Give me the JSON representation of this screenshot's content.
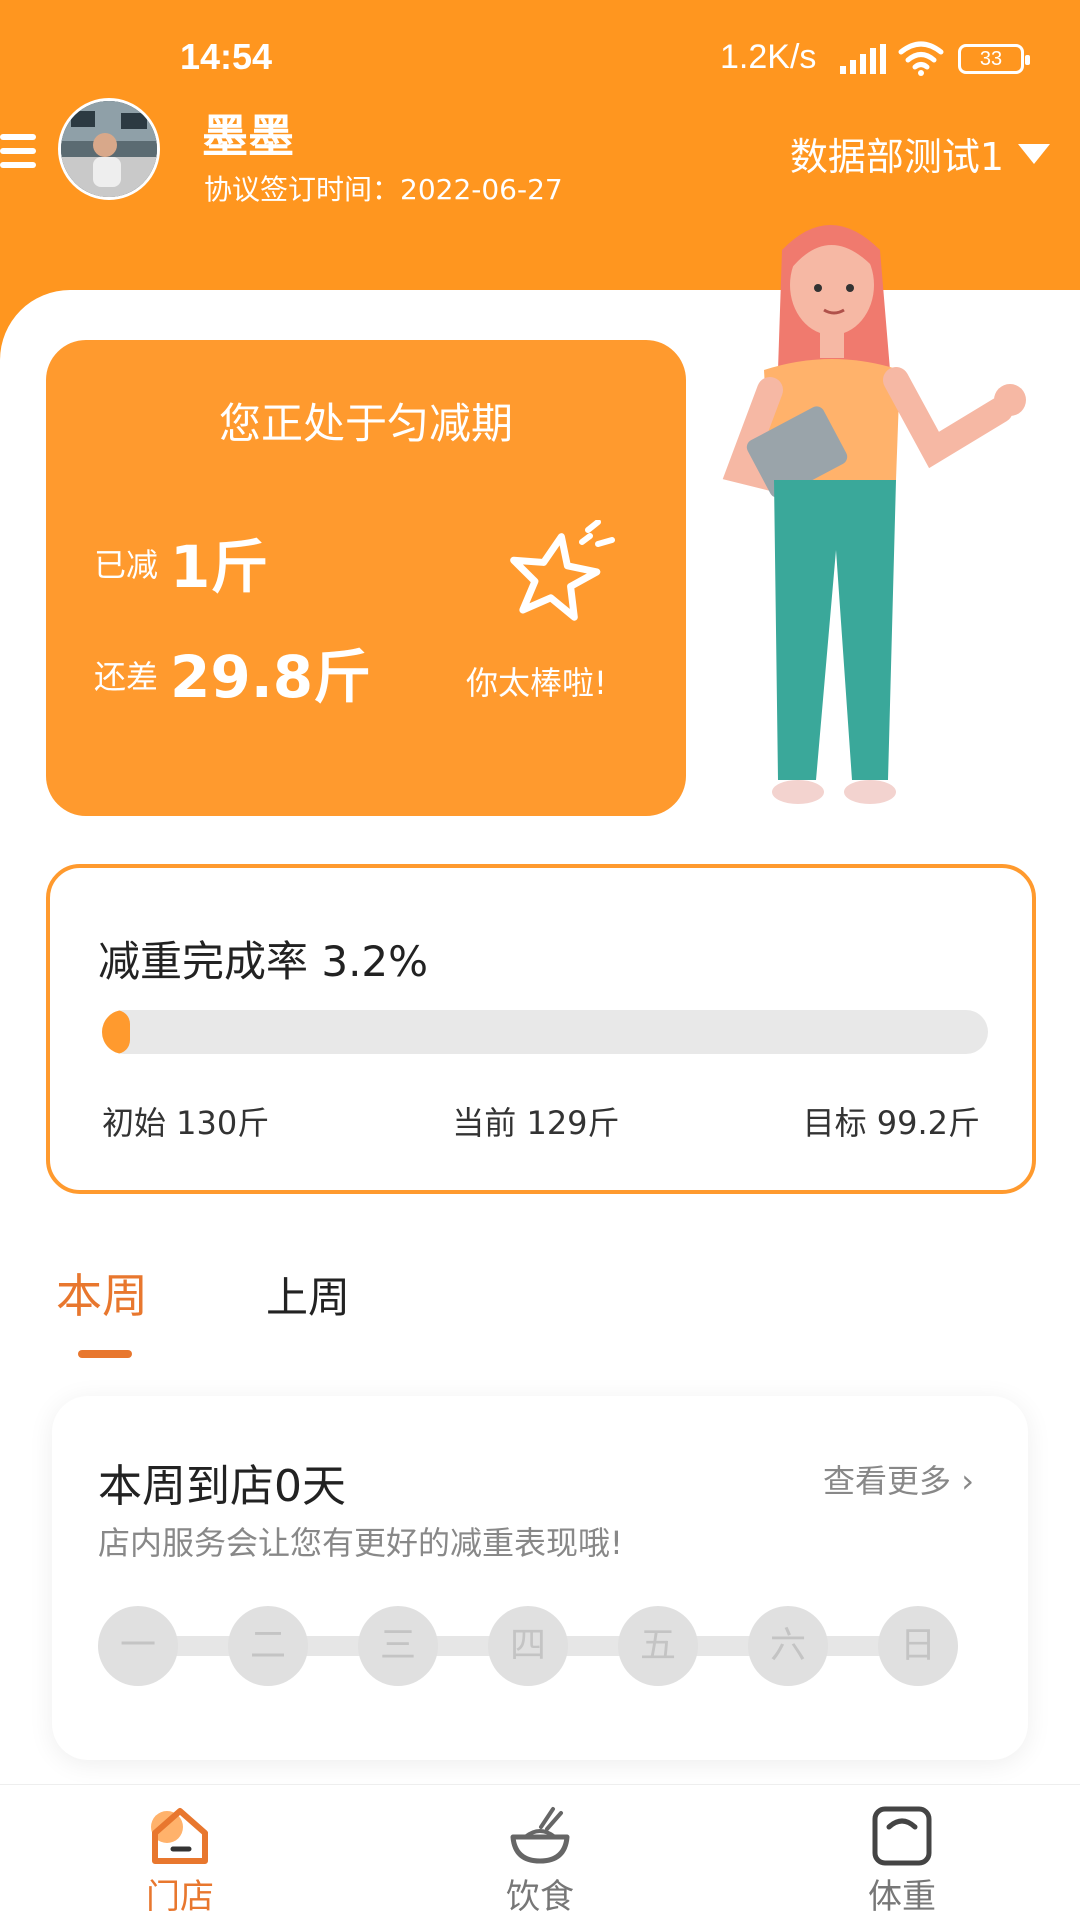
{
  "status_bar": {
    "time": "14:54",
    "network_speed": "1.2K/s",
    "battery": "33"
  },
  "header": {
    "user_name": "墨墨",
    "contract_date": "协议签订时间：2022-06-27",
    "department": "数据部测试1"
  },
  "status_card": {
    "phase_title": "您正处于匀减期",
    "lost_label": "已减",
    "lost_value": "1斤",
    "remain_label": "还差",
    "remain_value": "29.8斤",
    "cheer_text": "你太棒啦!"
  },
  "progress": {
    "title": "减重完成率 3.2%",
    "completion_percent": 3.2,
    "initial": "初始 130斤",
    "current": "当前 129斤",
    "target": "目标 99.2斤"
  },
  "tabs": {
    "this_week": "本周",
    "last_week": "上周"
  },
  "visit_card": {
    "title": "本周到店0天",
    "view_more": "查看更多 ›",
    "subtitle": "店内服务会让您有更好的减重表现哦!",
    "days": [
      "一",
      "二",
      "三",
      "四",
      "五",
      "六",
      "日"
    ]
  },
  "bottom_nav": {
    "store": "门店",
    "diet": "饮食",
    "weight": "体重"
  },
  "colors": {
    "brand_orange": "#FF961F",
    "accent_orange": "#E8772E",
    "track_gray": "#E8E8E8"
  }
}
